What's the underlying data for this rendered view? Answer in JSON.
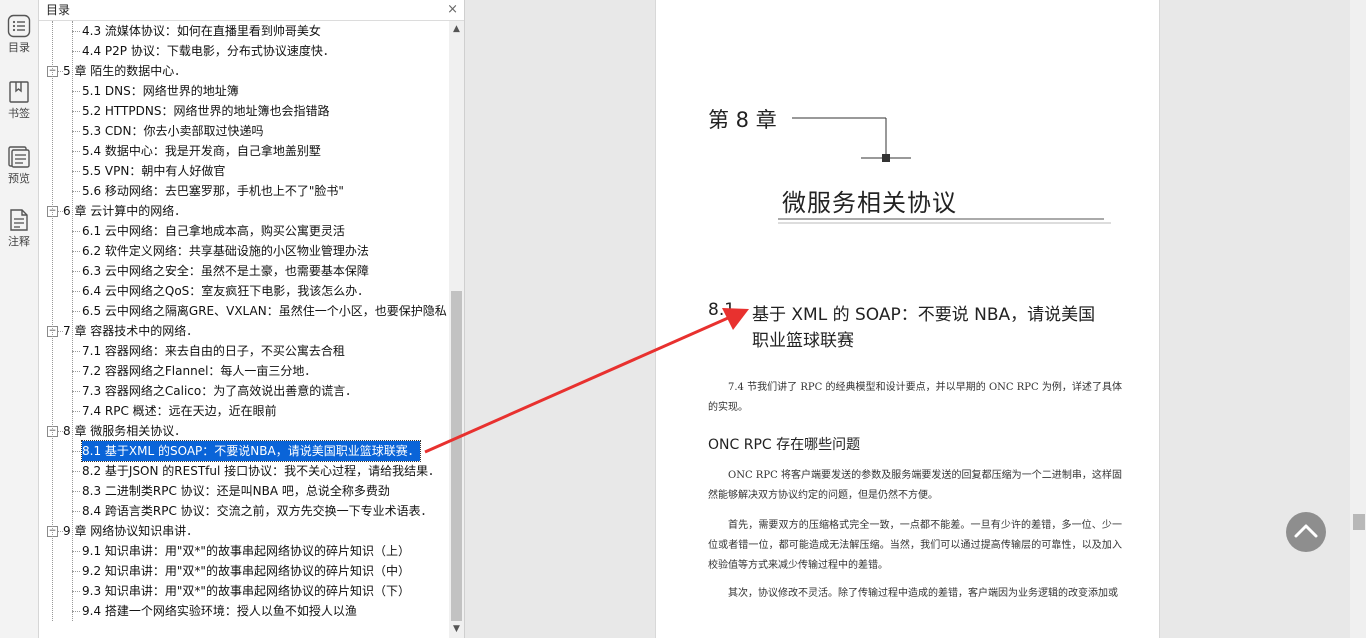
{
  "sidebar": {
    "items": [
      {
        "label": "目录",
        "icon": "toc-list-icon"
      },
      {
        "label": "书签",
        "icon": "bookmark-icon"
      },
      {
        "label": "预览",
        "icon": "preview-icon"
      },
      {
        "label": "注释",
        "icon": "annotation-icon"
      }
    ]
  },
  "toc": {
    "title": "目录",
    "close": "×",
    "rows": [
      {
        "kind": "sec",
        "text": "4.3 流媒体协议：如何在直播里看到帅哥美女"
      },
      {
        "kind": "sec",
        "text": "4.4 P2P 协议：下载电影，分布式协议速度快．"
      },
      {
        "kind": "ch",
        "text": "5 章 陌生的数据中心．"
      },
      {
        "kind": "sec",
        "text": "5.1 DNS：网络世界的地址簿"
      },
      {
        "kind": "sec",
        "text": "5.2 HTTPDNS：网络世界的地址簿也会指错路"
      },
      {
        "kind": "sec",
        "text": "5.3 CDN：你去小卖部取过快递吗"
      },
      {
        "kind": "sec",
        "text": "5.4 数据中心：我是开发商，自己拿地盖别墅"
      },
      {
        "kind": "sec",
        "text": "5.5 VPN：朝中有人好做官"
      },
      {
        "kind": "sec",
        "text": "5.6 移动网络：去巴塞罗那，手机也上不了\"脸书\""
      },
      {
        "kind": "ch",
        "text": "6 章 云计算中的网络．"
      },
      {
        "kind": "sec",
        "text": "6.1 云中网络：自己拿地成本高，购买公寓更灵活"
      },
      {
        "kind": "sec",
        "text": "6.2 软件定义网络：共享基础设施的小区物业管理办法"
      },
      {
        "kind": "sec",
        "text": "6.3 云中网络之安全：虽然不是土豪，也需要基本保障"
      },
      {
        "kind": "sec",
        "text": "6.4 云中网络之QoS：室友疯狂下电影，我该怎么办．"
      },
      {
        "kind": "sec",
        "text": "6.5 云中网络之隔离GRE、VXLAN：虽然住一个小区，也要保护隐私"
      },
      {
        "kind": "ch",
        "text": "7 章 容器技术中的网络．"
      },
      {
        "kind": "sec",
        "text": "7.1 容器网络：来去自由的日子，不买公寓去合租"
      },
      {
        "kind": "sec",
        "text": "7.2 容器网络之Flannel：每人一亩三分地．"
      },
      {
        "kind": "sec",
        "text": "7.3 容器网络之Calico：为了高效说出善意的谎言．"
      },
      {
        "kind": "sec",
        "text": "7.4 RPC 概述：远在天边，近在眼前"
      },
      {
        "kind": "ch",
        "text": "8 章 微服务相关协议．"
      },
      {
        "kind": "sec",
        "text": "8.1 基于XML 的SOAP：不要说NBA，请说美国职业篮球联赛．",
        "selected": true
      },
      {
        "kind": "sec",
        "text": "8.2 基于JSON 的RESTful 接口协议：我不关心过程，请给我结果．"
      },
      {
        "kind": "sec",
        "text": "8.3 二进制类RPC 协议：还是叫NBA 吧，总说全称多费劲"
      },
      {
        "kind": "sec",
        "text": "8.4 跨语言类RPC 协议：交流之前，双方先交换一下专业术语表．"
      },
      {
        "kind": "ch",
        "text": "9 章 网络协议知识串讲．"
      },
      {
        "kind": "sec",
        "text": "9.1 知识串讲：用\"双*\"的故事串起网络协议的碎片知识（上）"
      },
      {
        "kind": "sec",
        "text": "9.2 知识串讲：用\"双*\"的故事串起网络协议的碎片知识（中）"
      },
      {
        "kind": "sec",
        "text": "9.3 知识串讲：用\"双*\"的故事串起网络协议的碎片知识（下）"
      },
      {
        "kind": "sec",
        "text": "9.4 搭建一个网络实验环境：授人以鱼不如授人以渔"
      }
    ]
  },
  "page": {
    "chapter_label": "第 8 章",
    "chapter_title": "微服务相关协议",
    "section_num": "8.1",
    "section_title_line1": "基于 XML 的 SOAP：不要说 NBA，请说美国",
    "section_title_line2": "职业篮球联赛",
    "para1": "7.4 节我们讲了 RPC 的经典模型和设计要点，并以早期的 ONC RPC 为例，详述了具体的实现。",
    "subheading": "ONC RPC 存在哪些问题",
    "para2": "ONC RPC 将客户端要发送的参数及服务端要发送的回复都压缩为一个二进制串，这样固然能够解决双方协议约定的问题，但是仍然不方便。",
    "para3": "首先，需要双方的压缩格式完全一致，一点都不能差。一旦有少许的差错，多一位、少一位或者错一位，都可能造成无法解压缩。当然，我们可以通过提高传输层的可靠性，以及加入校验值等方式来减少传输过程中的差错。",
    "para4": "其次，协议修改不灵活。除了传输过程中造成的差错，客户端因为业务逻辑的改变添加或"
  },
  "colors": {
    "selection": "#0a64d8",
    "arrow": "#e8312f",
    "page_bg": "#e8e8e8"
  }
}
